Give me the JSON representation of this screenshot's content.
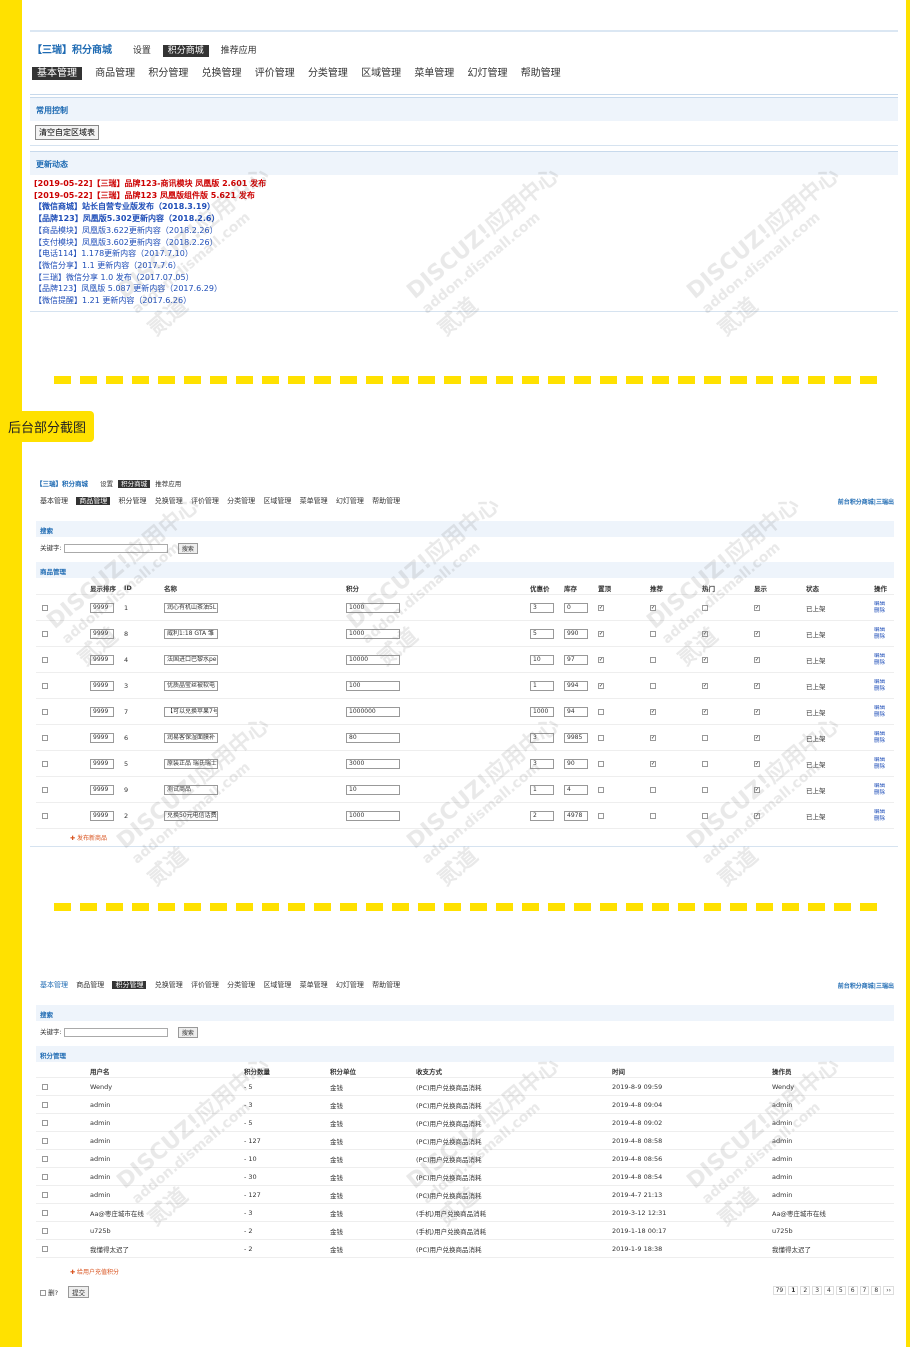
{
  "screen1": {
    "brand": "【三瑞】积分商城",
    "top_links": [
      "设置",
      "积分商城",
      "推荐应用"
    ],
    "tabs": [
      "基本管理",
      "商品管理",
      "积分管理",
      "兑换管理",
      "评价管理",
      "分类管理",
      "区域管理",
      "菜单管理",
      "幻灯管理",
      "帮助管理"
    ],
    "section1": "常用控制",
    "clear_button": "清空自定区域表",
    "section2": "更新动态",
    "news": [
      {
        "text": "[2019-05-22]【三瑞】品牌123-商讯模块 凤凰版 2.601 发布",
        "style": "red"
      },
      {
        "text": "[2019-05-22]【三瑞】品牌123 凤凰版组件版 5.621 发布",
        "style": "red"
      },
      {
        "text": "【微信商城】站长自营专业版发布（2018.3.19）",
        "style": "bold"
      },
      {
        "text": "【品牌123】凤凰版5.302更新内容（2018.2.6）",
        "style": "bold"
      },
      {
        "text": "【商品模块】凤凰版3.622更新内容（2018.2.26）",
        "style": ""
      },
      {
        "text": "【支付模块】凤凰版3.602更新内容（2018.2.26）",
        "style": ""
      },
      {
        "text": "【电话114】1.178更新内容（2017.7.10）",
        "style": ""
      },
      {
        "text": "【微信分享】1.1 更新内容（2017.7.6）",
        "style": ""
      },
      {
        "text": "【三瑞】微信分享 1.0 发布（2017.07.05）",
        "style": ""
      },
      {
        "text": "【品牌123】凤凰版 5.087 更新内容（2017.6.29）",
        "style": ""
      },
      {
        "text": "【微信提醒】1.21 更新内容（2017.6.26）",
        "style": ""
      }
    ]
  },
  "label": "后台部分截图",
  "screen2": {
    "brand": "【三瑞】积分商城",
    "top_links": [
      "设置",
      "积分商城",
      "推荐应用"
    ],
    "tabs": [
      "基本管理",
      "商品管理",
      "积分管理",
      "兑换管理",
      "评价管理",
      "分类管理",
      "区域管理",
      "菜单管理",
      "幻灯管理",
      "帮助管理"
    ],
    "right_link": "前台积分商城|三瑞出",
    "search_title": "搜索",
    "search_label": "关键字:",
    "search_button": "搜索",
    "list_title": "商品管理",
    "columns": [
      "显示排序",
      "ID",
      "名称",
      "积分",
      "优惠价",
      "库存",
      "置顶",
      "推荐",
      "热门",
      "显示",
      "状态",
      "操作"
    ],
    "rows": [
      {
        "order": "9999",
        "id": "1",
        "name": "润心有机山茶油5L",
        "price": "1000",
        "discount": "3",
        "stock": "0",
        "top": true,
        "rec": true,
        "hot": false,
        "show": true,
        "status": "已上架"
      },
      {
        "order": "9999",
        "id": "8",
        "name": "威利1:18 GTA 雏",
        "price": "1000",
        "discount": "5",
        "stock": "990",
        "top": true,
        "rec": false,
        "hot": true,
        "show": true,
        "status": "已上架"
      },
      {
        "order": "9999",
        "id": "4",
        "name": "法国进口巴黎水pe",
        "price": "10000",
        "discount": "10",
        "stock": "97",
        "top": true,
        "rec": false,
        "hot": true,
        "show": true,
        "status": "已上架"
      },
      {
        "order": "9999",
        "id": "3",
        "name": "优质晶莹丝被软电",
        "price": "100",
        "discount": "1",
        "stock": "994",
        "top": true,
        "rec": false,
        "hot": true,
        "show": true,
        "status": "已上架"
      },
      {
        "order": "9999",
        "id": "7",
        "name": "【可以兑换苹果7号",
        "price": "1000000",
        "discount": "1000",
        "stock": "94",
        "top": false,
        "rec": true,
        "hot": true,
        "show": true,
        "status": "已上架"
      },
      {
        "order": "9999",
        "id": "6",
        "name": "润易客保湿面膜补",
        "price": "80",
        "discount": "3",
        "stock": "9985",
        "top": false,
        "rec": true,
        "hot": false,
        "show": true,
        "status": "已上架"
      },
      {
        "order": "9999",
        "id": "5",
        "name": "原装正品 瑞氏瑞士",
        "price": "3000",
        "discount": "3",
        "stock": "90",
        "top": false,
        "rec": true,
        "hot": false,
        "show": true,
        "status": "已上架"
      },
      {
        "order": "9999",
        "id": "9",
        "name": "测试商品",
        "price": "10",
        "discount": "1",
        "stock": "4",
        "top": false,
        "rec": false,
        "hot": false,
        "show": true,
        "status": "已上架"
      },
      {
        "order": "9999",
        "id": "2",
        "name": "兑换50元电信话费",
        "price": "1000",
        "discount": "2",
        "stock": "4978",
        "top": false,
        "rec": false,
        "hot": false,
        "show": true,
        "status": "已上架"
      }
    ],
    "ops": [
      "编辑",
      "删除"
    ],
    "add_link": "发布新商品"
  },
  "screen3": {
    "tabs": [
      "基本管理",
      "商品管理",
      "积分管理",
      "兑换管理",
      "评价管理",
      "分类管理",
      "区域管理",
      "菜单管理",
      "幻灯管理",
      "帮助管理"
    ],
    "right_link": "前台积分商城|三瑞出",
    "search_title": "搜索",
    "search_label": "关键字:",
    "search_button": "搜索",
    "list_title": "积分管理",
    "columns": [
      "用户名",
      "积分数量",
      "积分单位",
      "收支方式",
      "时间",
      "操作员"
    ],
    "rows": [
      {
        "user": "Wendy",
        "amount": "- 5",
        "unit": "金钱",
        "method": "(PC)用户兑换商品消耗",
        "time": "2019-8-9 09:59",
        "op": "Wendy"
      },
      {
        "user": "admin",
        "amount": "- 3",
        "unit": "金钱",
        "method": "(PC)用户兑换商品消耗",
        "time": "2019-4-8 09:04",
        "op": "admin"
      },
      {
        "user": "admin",
        "amount": "- 5",
        "unit": "金钱",
        "method": "(PC)用户兑换商品消耗",
        "time": "2019-4-8 09:02",
        "op": "admin"
      },
      {
        "user": "admin",
        "amount": "- 127",
        "unit": "金钱",
        "method": "(PC)用户兑换商品消耗",
        "time": "2019-4-8 08:58",
        "op": "admin"
      },
      {
        "user": "admin",
        "amount": "- 10",
        "unit": "金钱",
        "method": "(PC)用户兑换商品消耗",
        "time": "2019-4-8 08:56",
        "op": "admin"
      },
      {
        "user": "admin",
        "amount": "- 30",
        "unit": "金钱",
        "method": "(PC)用户兑换商品消耗",
        "time": "2019-4-8 08:54",
        "op": "admin"
      },
      {
        "user": "admin",
        "amount": "- 127",
        "unit": "金钱",
        "method": "(PC)用户兑换商品消耗",
        "time": "2019-4-7 21:13",
        "op": "admin"
      },
      {
        "user": "Aa@枣庄城市在线",
        "amount": "- 3",
        "unit": "金钱",
        "method": "(手机)用户兑换商品消耗",
        "time": "2019-3-12 12:31",
        "op": "Aa@枣庄城市在线"
      },
      {
        "user": "u725b",
        "amount": "- 2",
        "unit": "金钱",
        "method": "(手机)用户兑换商品消耗",
        "time": "2019-1-18 00:17",
        "op": "u725b"
      },
      {
        "user": "我懂得太迟了",
        "amount": "- 2",
        "unit": "金钱",
        "method": "(PC)用户兑换商品消耗",
        "time": "2019-1-9 18:38",
        "op": "我懂得太迟了"
      }
    ],
    "add_link": "给用户充值积分",
    "delete_label": "删?",
    "submit_button": "提交",
    "pager": [
      "79",
      "1",
      "2",
      "3",
      "4",
      "5",
      "6",
      "7",
      "8",
      "››"
    ]
  },
  "watermark": {
    "line1": "DISCUZ!应用中心",
    "line2": "addon.dismall.com",
    "line3": "贰道"
  }
}
